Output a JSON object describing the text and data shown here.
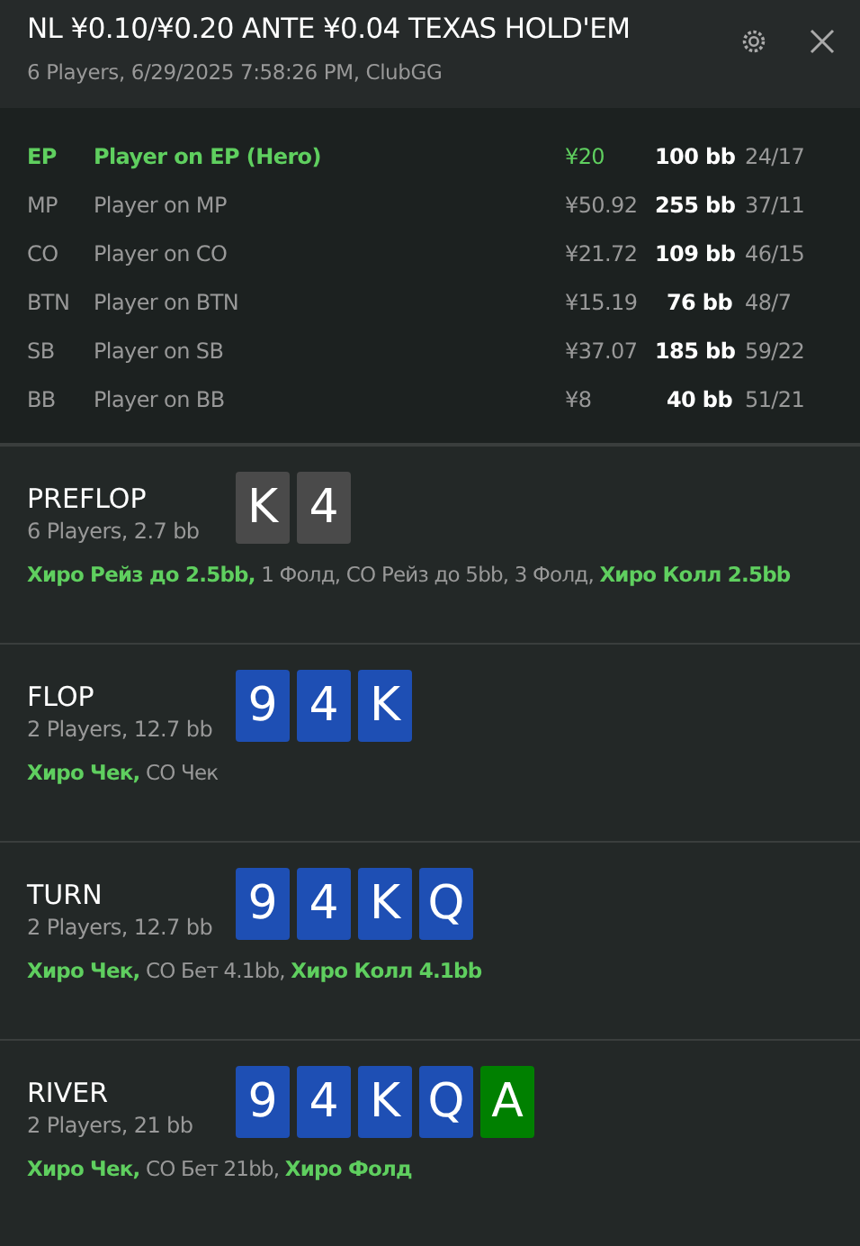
{
  "header": {
    "title": "NL ¥0.10/¥0.20 ANTE ¥0.04 TEXAS HOLD'EM",
    "subtitle": "6 Players, 6/29/2025 7:58:26 PM, ClubGG"
  },
  "players": [
    {
      "position": "EP",
      "name": "Player on EP (Hero)",
      "stack": "¥20",
      "bb": "100 bb",
      "stats": "24/17",
      "hero": true
    },
    {
      "position": "MP",
      "name": "Player on MP",
      "stack": "¥50.92",
      "bb": "255 bb",
      "stats": "37/11",
      "hero": false
    },
    {
      "position": "CO",
      "name": "Player on CO",
      "stack": "¥21.72",
      "bb": "109 bb",
      "stats": "46/15",
      "hero": false
    },
    {
      "position": "BTN",
      "name": "Player on BTN",
      "stack": "¥15.19",
      "bb": "76 bb",
      "stats": "48/7",
      "hero": false
    },
    {
      "position": "SB",
      "name": "Player on SB",
      "stack": "¥37.07",
      "bb": "185 bb",
      "stats": "59/22",
      "hero": false
    },
    {
      "position": "BB",
      "name": "Player on BB",
      "stack": "¥8",
      "bb": "40 bb",
      "stats": "51/21",
      "hero": false
    }
  ],
  "streets": [
    {
      "name": "PREFLOP",
      "info": "6 Players, 2.7 bb",
      "cards": [
        {
          "rank": "K",
          "color": "#4a4a4a"
        },
        {
          "rank": "4",
          "color": "#4a4a4a"
        }
      ],
      "actions": "**Хиро Рейз до 2.5bb,** 1 Фолд, CO Рейз до 5bb, 3 Фолд, **Хиро Колл 2.5bb**"
    },
    {
      "name": "FLOP",
      "info": "2 Players, 12.7 bb",
      "cards": [
        {
          "rank": "9",
          "color": "#1e4fb4"
        },
        {
          "rank": "4",
          "color": "#1e4fb4"
        },
        {
          "rank": "K",
          "color": "#1e4fb4"
        }
      ],
      "actions": "**Хиро Чек,** CO Чек"
    },
    {
      "name": "TURN",
      "info": "2 Players, 12.7 bb",
      "cards": [
        {
          "rank": "9",
          "color": "#1e4fb4"
        },
        {
          "rank": "4",
          "color": "#1e4fb4"
        },
        {
          "rank": "K",
          "color": "#1e4fb4"
        },
        {
          "rank": "Q",
          "color": "#1e4fb4"
        }
      ],
      "actions": "**Хиро Чек,** CO Бет 4.1bb, **Хиро Колл 4.1bb**"
    },
    {
      "name": "RIVER",
      "info": "2 Players, 21 bb",
      "cards": [
        {
          "rank": "9",
          "color": "#1e4fb4"
        },
        {
          "rank": "4",
          "color": "#1e4fb4"
        },
        {
          "rank": "K",
          "color": "#1e4fb4"
        },
        {
          "rank": "Q",
          "color": "#1e4fb4"
        },
        {
          "rank": "A",
          "color": "#008000"
        }
      ],
      "actions": "**Хиро Чек,** CO Бет 21bb, **Хиро Фолд**"
    }
  ]
}
